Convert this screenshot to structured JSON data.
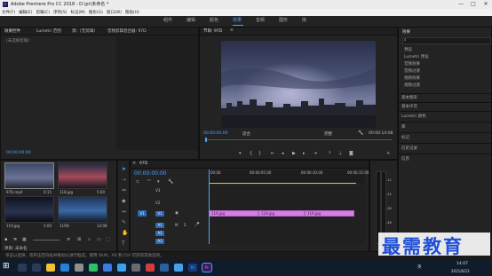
{
  "window": {
    "title": "Adobe Premiere Pro CC 2018 - D:\\pr\\未命名 *",
    "min": "—",
    "max": "□",
    "close": "✕"
  },
  "menu": [
    "文件(F)",
    "编辑(E)",
    "剪辑(C)",
    "序列(S)",
    "标记(M)",
    "图形(G)",
    "窗口(W)",
    "帮助(H)"
  ],
  "workspaces": [
    "组件",
    "编辑",
    "颜色",
    "效果",
    "音频",
    "图形",
    "库"
  ],
  "active_workspace": "效果",
  "effect_controls": {
    "tabs": [
      "效果控件",
      "Lumetri 范围",
      "源：(无剪辑)",
      "音频剪辑混合器: 97D"
    ],
    "empty": "(未选择剪辑)",
    "time": "00:00:00:00"
  },
  "program": {
    "tab": "节目: 97D",
    "timecode": "00:00:00:00",
    "fit": "适合",
    "quality": "完整",
    "duration": "00:00:14:08"
  },
  "effects_panel": {
    "title": "效果",
    "tree": [
      "预设",
      "Lumetri 预设",
      "音频效果",
      "音频过渡",
      "视频效果",
      "视频过渡"
    ],
    "sections": [
      "基本图形",
      "基本声音",
      "Lumetri 颜色",
      "库",
      "标记",
      "历史记录",
      "信息"
    ]
  },
  "project": {
    "label": "项目: 未命名",
    "items": [
      {
        "name": "97D.mp4",
        "dur": "0:15"
      },
      {
        "name": "118.jpg",
        "dur": "5:00"
      },
      {
        "name": "119.jpg",
        "dur": "5:00"
      },
      {
        "name": "119D",
        "dur": "14:08"
      }
    ]
  },
  "timeline": {
    "tab": "97D",
    "timecode": "00:00:00:00",
    "ruler": [
      "00:00",
      "00:00:05:00",
      "00:00:10:00",
      "00:00:15:00"
    ],
    "video_tracks": [
      "V3",
      "V2",
      "V1"
    ],
    "audio_tracks": [
      "A1",
      "A2",
      "A3"
    ],
    "clips": [
      "119.jpg",
      "118.jpg",
      "119.jpg"
    ]
  },
  "status": "单击以选择，或单击空白处并拖动以进行框选。使用 Shift、Alt 和 Ctrl 可获得其他选项。",
  "meters": [
    "-12",
    "-24",
    "-36",
    "-48",
    "dB"
  ],
  "watermark": "最需教育",
  "taskbar": {
    "time": "14:07",
    "date": "2021/6/23",
    "lang": "英"
  },
  "colors": {
    "accent": "#4ea1ff",
    "clip": "#d77ee6",
    "video_track_active": "#2d64b4"
  }
}
